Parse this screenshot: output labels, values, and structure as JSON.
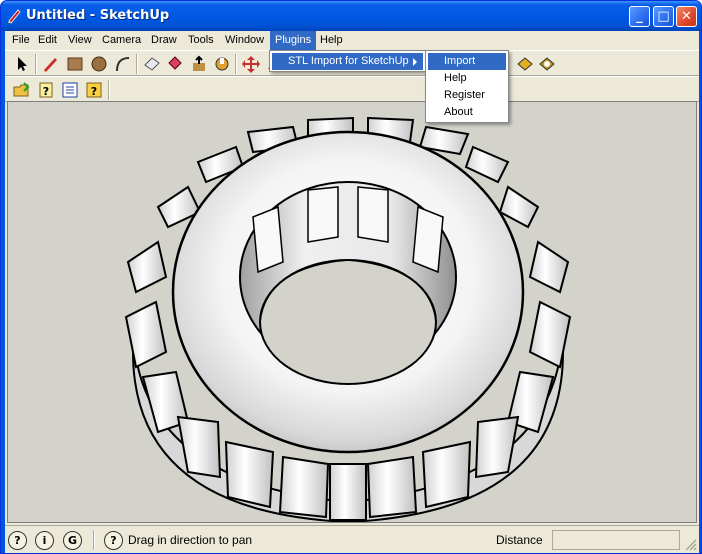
{
  "window": {
    "title": "Untitled - SketchUp",
    "buttons": {
      "minimize": "_",
      "maximize": "□",
      "close": "✕"
    }
  },
  "menubar": {
    "items": [
      "File",
      "Edit",
      "View",
      "Camera",
      "Draw",
      "Tools",
      "Window",
      "Plugins",
      "Help"
    ],
    "active": "Plugins"
  },
  "plugins_menu": {
    "items": [
      {
        "label": "STL Import for SketchUp",
        "has_submenu": true,
        "highlighted": true
      }
    ]
  },
  "submenu": {
    "items": [
      {
        "label": "Import",
        "highlighted": true
      },
      {
        "label": "Help"
      },
      {
        "label": "Register"
      },
      {
        "label": "About"
      }
    ]
  },
  "toolbar1": {
    "icons": [
      "select-arrow-icon",
      "pencil-icon",
      "rectangle-icon",
      "circle-icon",
      "arc-icon",
      "eraser-icon",
      "paint-bucket-icon",
      "push-pull-icon",
      "follow-me-icon",
      "move-icon",
      "rotate-icon",
      "scale-icon",
      "offset-icon",
      "tape-measure-icon",
      "dimension-icon",
      "protractor-icon",
      "text-icon",
      "axes-icon",
      "3d-text-icon",
      "orbit-icon",
      "pan-icon",
      "zoom-icon",
      "zoom-window-icon",
      "zoom-extents-icon",
      "previous-view-icon",
      "next-view-icon",
      "position-camera-icon",
      "walk-icon",
      "look-around-icon",
      "section-plane-icon",
      "get-models-icon",
      "share-model-icon"
    ]
  },
  "toolbar2": {
    "icons": [
      "open-folder-icon",
      "help-icon",
      "list-icon",
      "question-icon"
    ]
  },
  "statusbar": {
    "icons": [
      "geo-location-icon",
      "credits-icon",
      "google-icon",
      "question-icon"
    ],
    "message": "Drag in direction to pan",
    "distance_label": "Distance",
    "distance_value": ""
  },
  "colors": {
    "titlebar": "#0058e6",
    "menu_highlight": "#316ac5",
    "viewport_bg": "#d3d2cb",
    "chrome": "#ece9d8"
  }
}
